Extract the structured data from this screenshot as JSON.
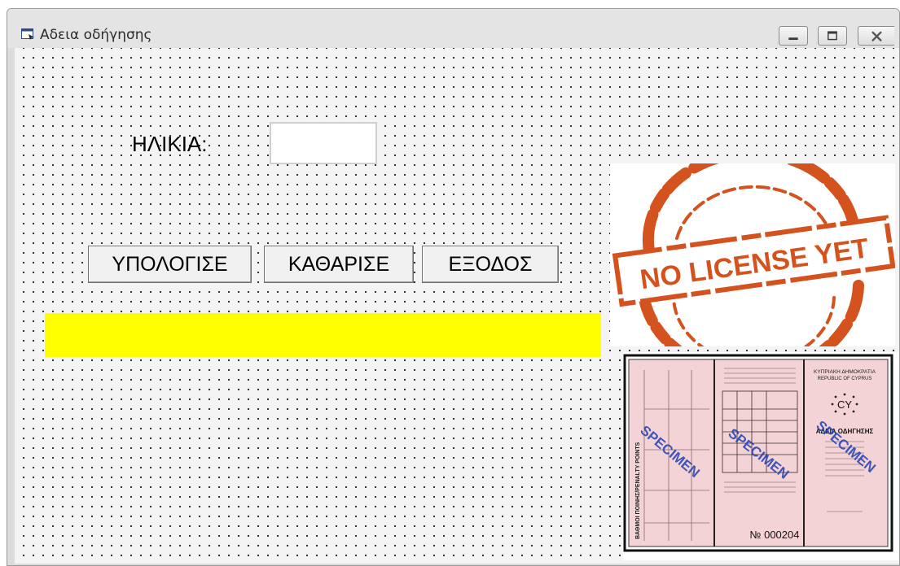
{
  "window": {
    "title": "Αδεια οδήγησης",
    "controls": {
      "minimize": "minimize-icon",
      "maximize": "maximize-icon",
      "close": "close-icon"
    }
  },
  "form": {
    "age_label": "ΗΛΙΚΙΑ:",
    "age_value": "",
    "buttons": {
      "calculate": "ΥΠΟΛΟΓΙΣΕ",
      "clear": "ΚΑΘΑΡΙΣΕ",
      "exit": "ΕΞΟΔΟΣ"
    },
    "result_text": ""
  },
  "images": {
    "stamp": {
      "text": "NO LICENSE YET"
    },
    "license": {
      "left_panel_title": "ΒΑΘΜΟΙ ΠΟΙΝΗΣ/PENALTY POINTS",
      "stamp_text": "SPECIMEN",
      "country": "ΚΥΠΡΙΑΚΗ ΔΗΜΟΚΡΑΤΙΑ",
      "country_en": "REPUBLIC OF CYPRUS",
      "code": "CY",
      "doc_title": "ΑΔΕΙΑ ΟΔΗΓΗΣΗΣ",
      "serial": "№ 000204"
    }
  },
  "colors": {
    "result_bg": "#ffff00",
    "stamp": "#d4521e",
    "license_bg": "#f4d3d6",
    "specimen": "#1e3fb4"
  }
}
